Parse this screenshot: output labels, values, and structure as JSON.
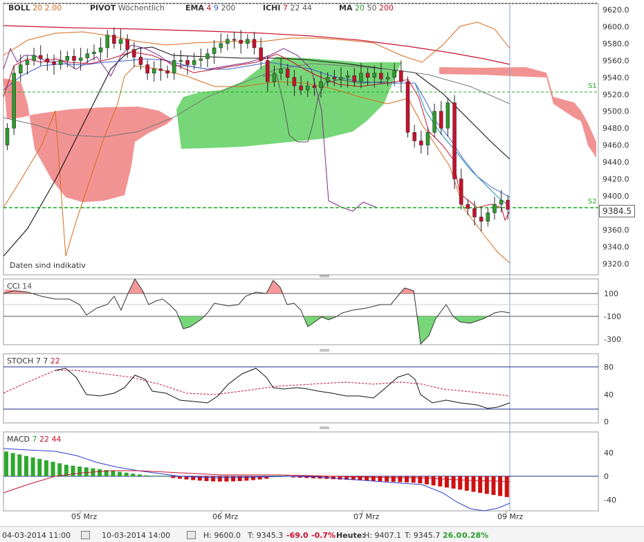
{
  "header": {
    "boll": {
      "name": "BOLL",
      "p1": "20",
      "p2": "2.00"
    },
    "pivot": {
      "name": "PIVOT",
      "p1": "Wöchentlich"
    },
    "ema": {
      "name": "EMA",
      "p1": "4",
      "p2": "9",
      "p3": "200"
    },
    "ichi": {
      "name": "ICHI",
      "p1": "7",
      "p2": "22",
      "p3": "44"
    },
    "ma": {
      "name": "MA",
      "p1": "20",
      "p2": "50",
      "p3": "200"
    }
  },
  "main": {
    "note": "Daten sind indikativ",
    "y_ticks": [
      "9620.0",
      "9600.0",
      "9580.0",
      "9560.0",
      "9540.0",
      "9520.0",
      "9500.0",
      "9480.0",
      "9460.0",
      "9440.0",
      "9420.0",
      "9400.0",
      "9380.0",
      "9360.0",
      "9340.0",
      "9320.0"
    ],
    "current_price": "9384.5",
    "s1_label": "S1",
    "s2_label": "S2"
  },
  "cci": {
    "label": "CCI",
    "period": "14",
    "y_ticks": [
      "100",
      "-100",
      "-300"
    ]
  },
  "stoch": {
    "label": "STOCH",
    "p1": "7",
    "p2": "7",
    "p3": "22",
    "y_ticks": [
      "80",
      "40",
      "0"
    ]
  },
  "macd": {
    "label": "MACD",
    "p1": "7",
    "p2": "22",
    "p3": "44",
    "y_ticks": [
      "40",
      "0",
      "-40"
    ]
  },
  "x_ticks": [
    "05 Mrz",
    "06 Mrz",
    "07 Mrz",
    "09 Mrz"
  ],
  "footer": {
    "from": "04-03-2014 11:00",
    "to": "10-03-2014 14:00",
    "h": "H: 9600.0",
    "t": "T: 9345.3",
    "chg": "-69.0",
    "chg_pct": "-0.7%",
    "heute": "Heute:",
    "heute_h": "H: 9407.1",
    "heute_t": "T: 9345.7",
    "heute_chg": "26.0",
    "heute_pct": "0.28%"
  },
  "colors": {
    "bull": "#2e9a2e",
    "bear": "#c8102e",
    "cloud_up": "#5fcf5f",
    "cloud_down": "#f08080",
    "support": "#22aa22",
    "accent": "#8aa0d0"
  },
  "chart_data": [
    {
      "type": "candlestick",
      "title": "",
      "ylim": [
        9310,
        9625
      ],
      "x_ticks": [
        "05 Mrz",
        "06 Mrz",
        "07 Mrz",
        "09 Mrz"
      ],
      "support_levels": [
        {
          "name": "S1",
          "value": 9522
        },
        {
          "name": "S2",
          "value": 9385
        }
      ],
      "last_price": 9384.5,
      "close_series": [
        9480,
        9545,
        9555,
        9560,
        9566,
        9562,
        9558,
        9555,
        9560,
        9565,
        9560,
        9563,
        9568,
        9570,
        9575,
        9590,
        9580,
        9585,
        9573,
        9564,
        9555,
        9545,
        9550,
        9548,
        9545,
        9560,
        9560,
        9555,
        9560,
        9562,
        9568,
        9575,
        9580,
        9585,
        9584,
        9580,
        9585,
        9575,
        9560,
        9535,
        9545,
        9550,
        9540,
        9530,
        9525,
        9530,
        9528,
        9535,
        9540,
        9538,
        9540,
        9542,
        9535,
        9545,
        9540,
        9545,
        9538,
        9540,
        9548,
        9535,
        9475,
        9465,
        9460,
        9475,
        9500,
        9480,
        9510,
        9420,
        9390,
        9385,
        9375,
        9370,
        9380,
        9390,
        9395,
        9384
      ]
    },
    {
      "type": "line",
      "name": "CCI",
      "ylim": [
        -350,
        220
      ],
      "x_ticks": [
        "05 Mrz",
        "06 Mrz",
        "07 Mrz",
        "09 Mrz"
      ]
    },
    {
      "type": "line",
      "name": "STOCH",
      "ylim": [
        0,
        100
      ],
      "x_ticks": [
        "05 Mrz",
        "06 Mrz",
        "07 Mrz",
        "09 Mrz"
      ]
    },
    {
      "type": "bar",
      "name": "MACD",
      "ylim": [
        -60,
        60
      ],
      "x_ticks": [
        "05 Mrz",
        "06 Mrz",
        "07 Mrz",
        "09 Mrz"
      ]
    }
  ]
}
